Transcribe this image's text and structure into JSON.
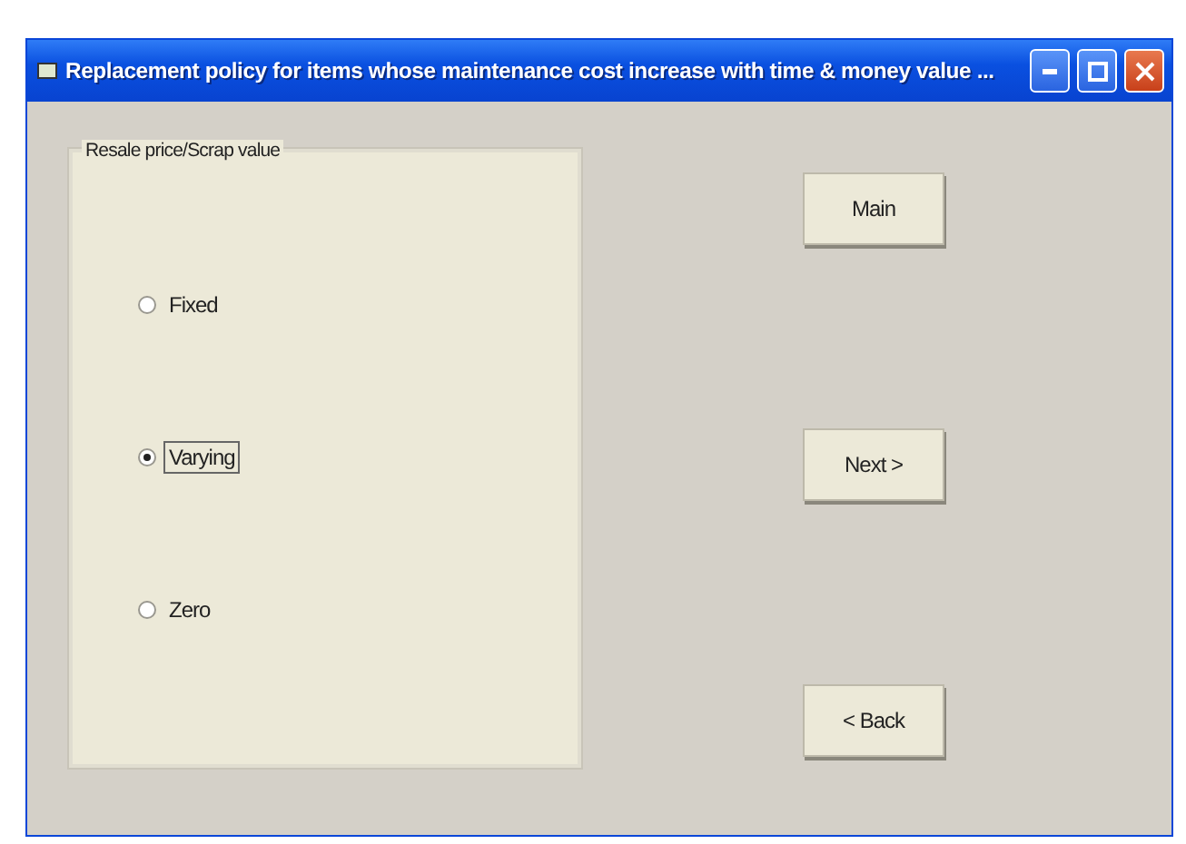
{
  "window": {
    "title": "Replacement policy for items whose maintenance cost increase with time & money value ..."
  },
  "group": {
    "label": "Resale price/Scrap value",
    "options": [
      {
        "label": "Fixed",
        "selected": false
      },
      {
        "label": "Varying",
        "selected": true
      },
      {
        "label": "Zero",
        "selected": false
      }
    ]
  },
  "buttons": [
    "Main",
    "Next >",
    "< Back"
  ]
}
